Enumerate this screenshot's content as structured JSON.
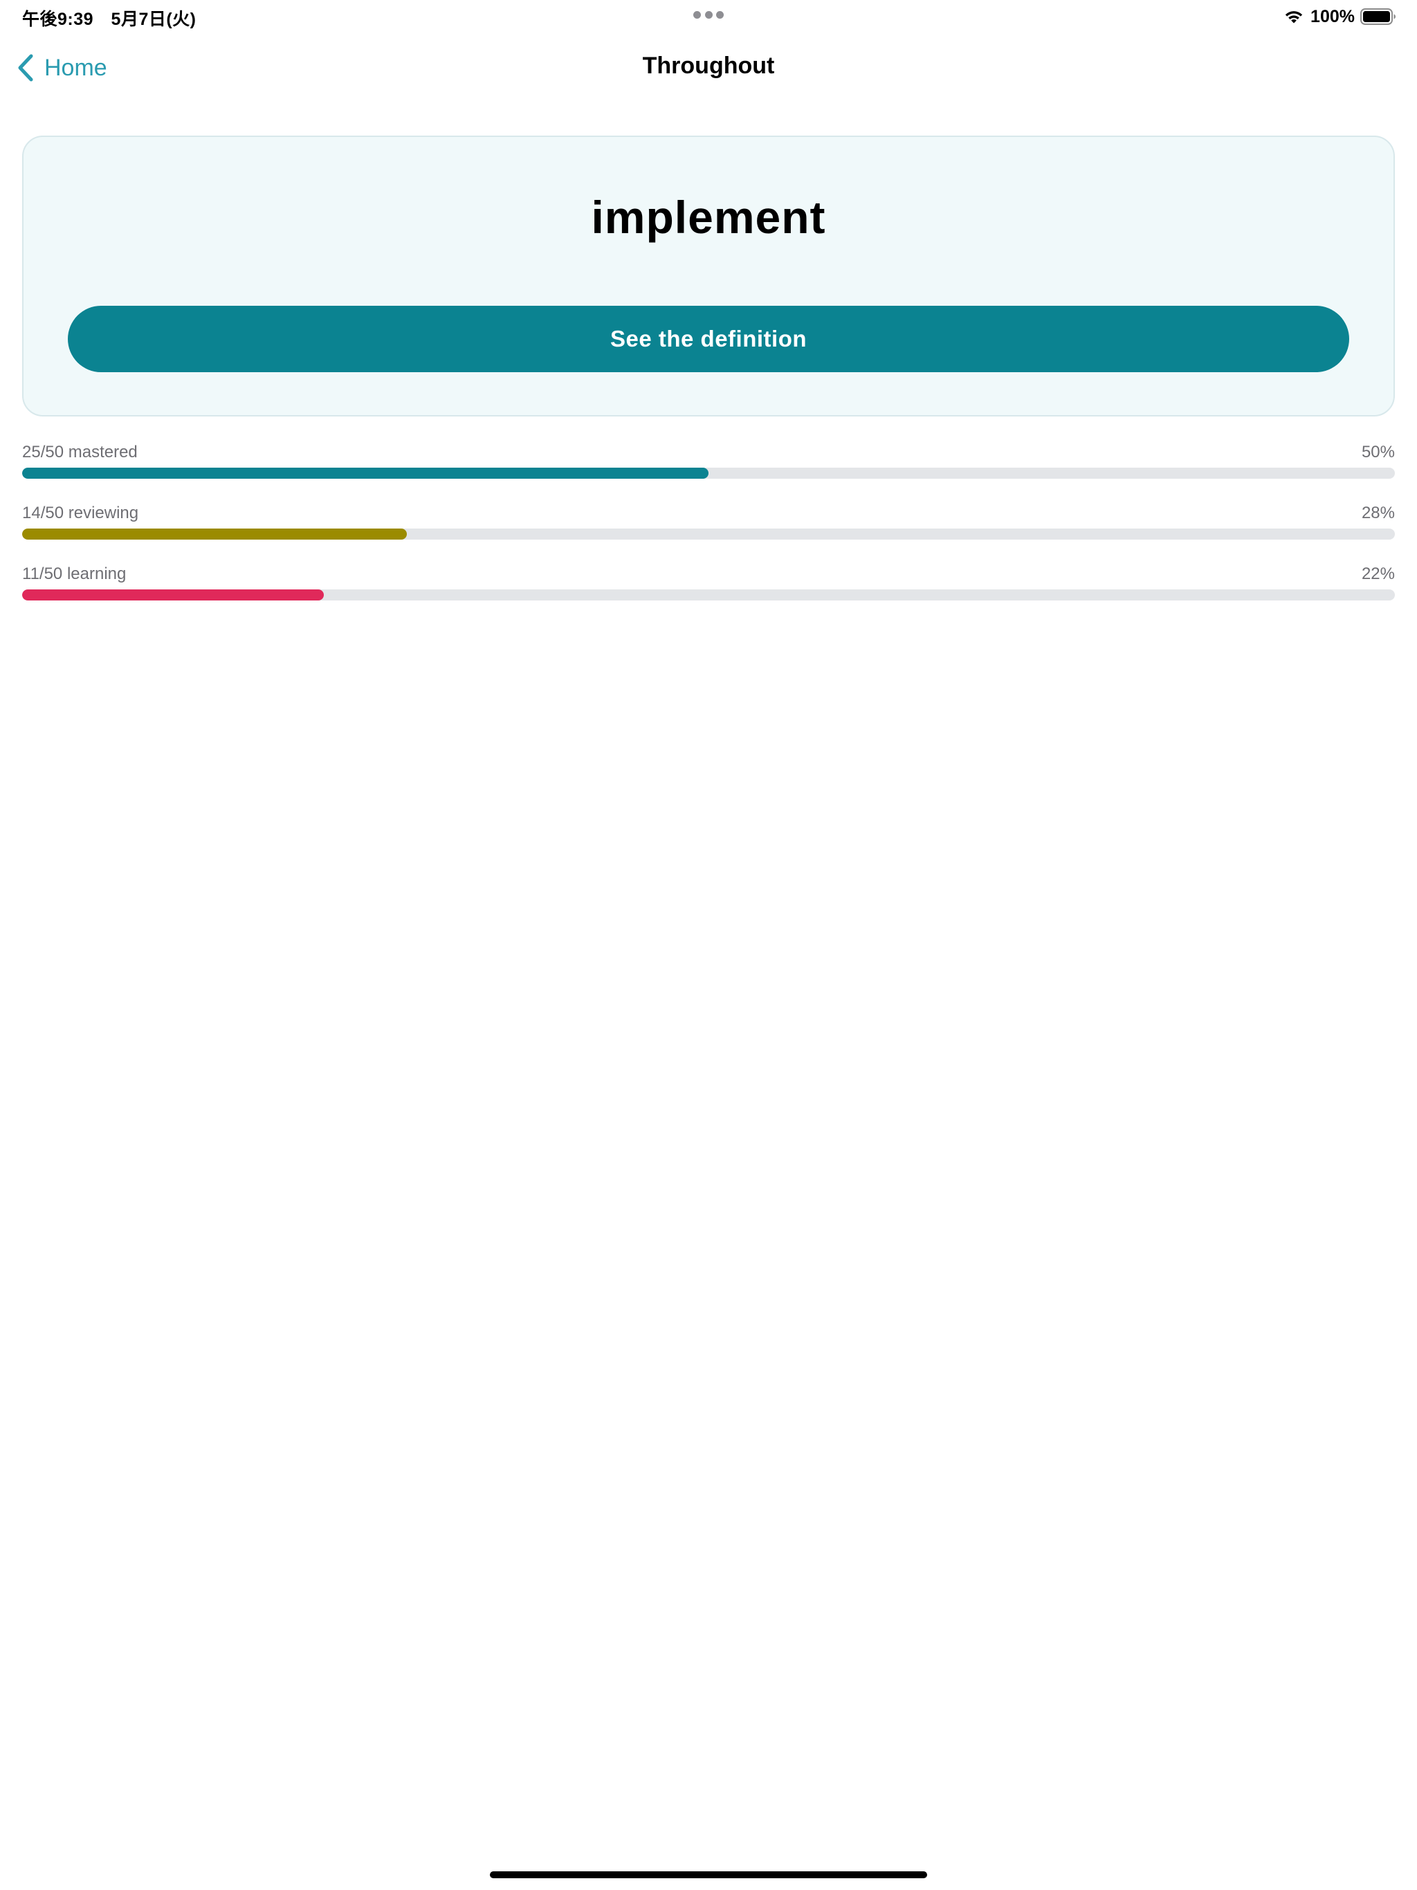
{
  "status_bar": {
    "time": "午後9:39　5月7日(火)",
    "battery_percent": "100%",
    "wifi_icon": "wifi-icon",
    "battery_icon": "battery-full-icon"
  },
  "nav": {
    "back_label": "Home",
    "back_icon": "chevron-left-icon",
    "title": "Throughout"
  },
  "card": {
    "term": "implement",
    "button_label": "See the definition"
  },
  "progress": [
    {
      "label": "25/50 mastered",
      "percent_label": "50%",
      "fraction": 0.5,
      "color": "#0b8391"
    },
    {
      "label": "14/50 reviewing",
      "percent_label": "28%",
      "fraction": 0.28,
      "color": "#9b8b00"
    },
    {
      "label": "11/50 learning",
      "percent_label": "22%",
      "fraction": 0.22,
      "color": "#e0295a"
    }
  ],
  "colors": {
    "accent": "#0b8391",
    "back_link": "#2a9bb0",
    "card_background": "#f0f9fa",
    "track": "#e3e5e8"
  }
}
